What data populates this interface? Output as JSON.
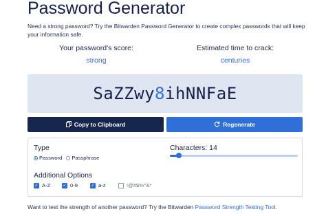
{
  "title": "Password Generator",
  "intro": "Need a strong password? Try the Bitwarden Password Generator to create complex passwords that will keep your information safe.",
  "score": {
    "label": "Your password's score:",
    "value": "strong"
  },
  "crack_time": {
    "label": "Estimated time to crack:",
    "value": "centuries"
  },
  "password": {
    "letters_a": "SaZZwy",
    "digit": "8",
    "letters_b": "ihNNFaE"
  },
  "buttons": {
    "copy_label": "Copy to Clipboard",
    "regenerate_label": "Regenerate"
  },
  "options": {
    "type_title": "Type",
    "type_choices": [
      "Password",
      "Passphrase"
    ],
    "type_selected": "Password",
    "characters_label": "Characters: 14",
    "characters_fraction": 0.07,
    "additional_title": "Additional Options",
    "checkboxes": [
      {
        "label": "A-Z",
        "checked": true
      },
      {
        "label": "0-9",
        "checked": true
      },
      {
        "label": "a-z",
        "checked": true
      },
      {
        "label": "!@#$%^&*",
        "checked": false
      }
    ]
  },
  "footer": {
    "text": "Want to test the strength of another password? Try the Bitwarden ",
    "link": "Password Strength Testing Tool",
    "end": "."
  },
  "colors": {
    "accent": "#2f6fd8",
    "navy": "#17264d",
    "panel": "#dfe6f2"
  }
}
